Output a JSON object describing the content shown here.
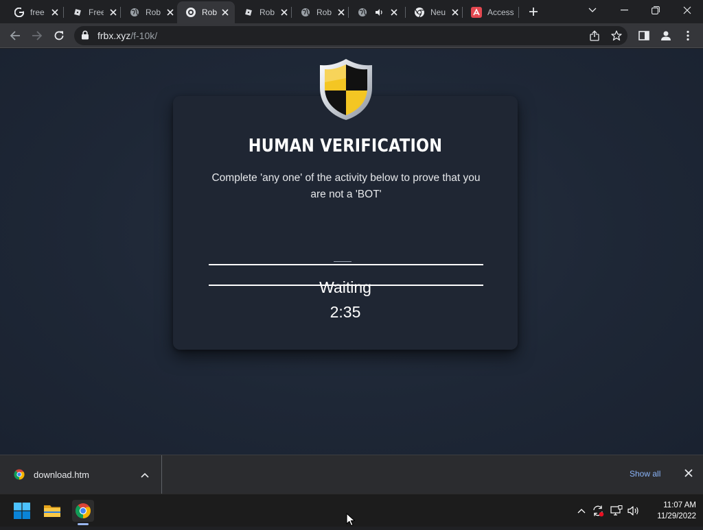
{
  "tabs": [
    {
      "title": "free",
      "icon": "google-icon"
    },
    {
      "title": "Free",
      "icon": "roblox-icon"
    },
    {
      "title": "Rob",
      "icon": "globe-icon"
    },
    {
      "title": "Rob",
      "icon": "roblox-circle-icon",
      "active": true
    },
    {
      "title": "Rob",
      "icon": "roblox-icon"
    },
    {
      "title": "Rob",
      "icon": "globe-icon"
    },
    {
      "title": "",
      "icon": "globe-icon",
      "audio": true
    },
    {
      "title": "Neu",
      "icon": "chrome-icon"
    },
    {
      "title": "Access",
      "icon": "adobe-icon"
    }
  ],
  "address_bar": {
    "domain": "frbx.xyz",
    "path": "/f-10k/"
  },
  "page": {
    "title": "HUMAN VERIFICATION",
    "description": "Complete 'any one' of the activity below to prove that you are not a 'BOT'",
    "status": "Waiting",
    "timer": "2:35"
  },
  "download_bar": {
    "filename": "download.htm",
    "show_all": "Show all"
  },
  "taskbar": {
    "time": "11:07 AM",
    "date": "11/29/2022"
  },
  "colors": {
    "accent_link": "#8ab4f8",
    "shield_yellow": "#f4c623",
    "page_bg": "#1e2736",
    "card_bg": "#1f2633"
  }
}
